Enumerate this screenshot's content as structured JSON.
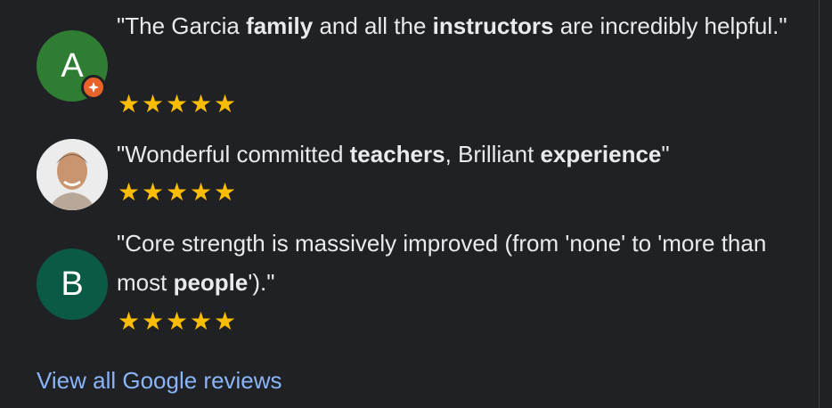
{
  "reviews": [
    {
      "avatar_letter": "A",
      "avatar_color": "#2e7d32",
      "has_badge": true,
      "segments": [
        {
          "t": "\"The Garcia ",
          "b": false
        },
        {
          "t": "family",
          "b": true
        },
        {
          "t": " and all the ",
          "b": false
        },
        {
          "t": "instructors",
          "b": true
        },
        {
          "t": " are incredibly helpful.\"",
          "b": false
        }
      ],
      "rating": 5
    },
    {
      "avatar_letter": "",
      "avatar_color": "#e0d6cc",
      "has_badge": false,
      "segments": [
        {
          "t": "\"Wonderful committed ",
          "b": false
        },
        {
          "t": "teachers",
          "b": true
        },
        {
          "t": ", Brilliant ",
          "b": false
        },
        {
          "t": "experience",
          "b": true
        },
        {
          "t": "\"",
          "b": false
        }
      ],
      "rating": 5
    },
    {
      "avatar_letter": "B",
      "avatar_color": "#0b5a45",
      "has_badge": false,
      "segments": [
        {
          "t": "\"Core strength is massively improved (from 'none' to 'more than most ",
          "b": false
        },
        {
          "t": "people",
          "b": true
        },
        {
          "t": "').\"",
          "b": false
        }
      ],
      "rating": 5
    }
  ],
  "view_all_link": "View all Google reviews",
  "colors": {
    "background": "#202124",
    "text": "#e8eaed",
    "star": "#fbbc04",
    "link": "#8ab4f8",
    "badge": "#e8632a"
  }
}
